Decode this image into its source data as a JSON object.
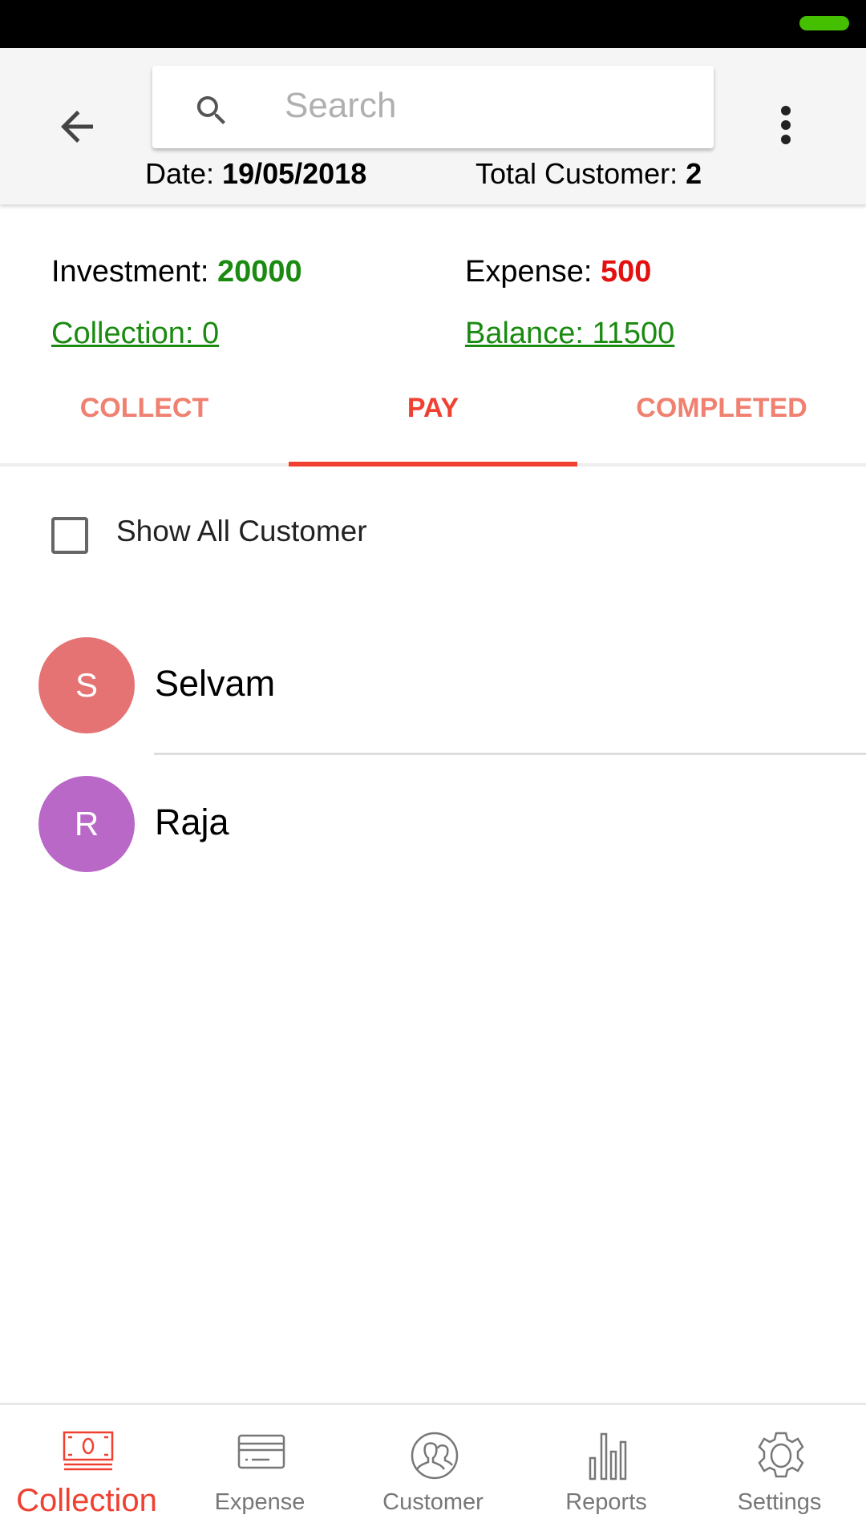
{
  "status_bar": {
    "battery_color": "#44c000"
  },
  "toolbar": {
    "back_icon": "arrow-left-icon",
    "search_placeholder": "Search",
    "search_value": "",
    "menu_icon": "more-vert-icon",
    "date_label": "Date: ",
    "date_value": "19/05/2018",
    "total_label": "Total Customer: ",
    "total_value": "2"
  },
  "summary": {
    "investment_label": "Investment: ",
    "investment_value": "20000",
    "expense_label": "Expense: ",
    "expense_value": "500",
    "collection_link": "Collection: 0",
    "balance_link": "Balance: 11500",
    "positive_color": "#1a8a10",
    "negative_color": "#e41010"
  },
  "tabs": [
    {
      "label": "COLLECT"
    },
    {
      "label": "PAY",
      "active": true
    },
    {
      "label": "COMPLETED"
    }
  ],
  "filter": {
    "show_all_label": "Show All Customer",
    "checked": false
  },
  "customers": [
    {
      "initial": "S",
      "name": "Selvam",
      "color": "#e57373"
    },
    {
      "initial": "R",
      "name": "Raja",
      "color": "#ba68c8"
    }
  ],
  "bottom_nav": [
    {
      "label": "Collection",
      "icon": "money-icon",
      "active": true
    },
    {
      "label": "Expense",
      "icon": "credit-card-icon"
    },
    {
      "label": "Customer",
      "icon": "people-icon"
    },
    {
      "label": "Reports",
      "icon": "bar-chart-icon"
    },
    {
      "label": "Settings",
      "icon": "gear-icon"
    }
  ],
  "accent_color": "#f04030"
}
